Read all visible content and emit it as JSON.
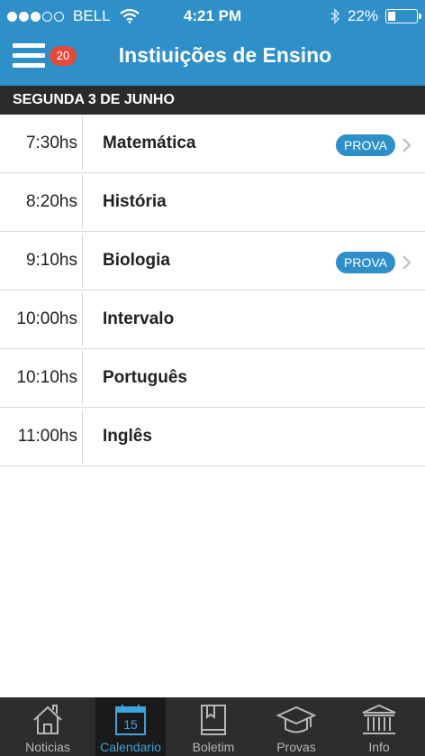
{
  "status_bar": {
    "carrier": "BELL",
    "time": "4:21 PM",
    "battery": "22%",
    "battery_level": 0.22
  },
  "header": {
    "title": "Instiuições de Ensino",
    "badge_count": "20"
  },
  "date_header": "SEGUNDA 3 DE JUNHO",
  "schedule": [
    {
      "time": "7:30hs",
      "subject": "Matemática",
      "tag": "PROVA"
    },
    {
      "time": "8:20hs",
      "subject": "História"
    },
    {
      "time": "9:10hs",
      "subject": "Biologia",
      "tag": "PROVA"
    },
    {
      "time": "10:00hs",
      "subject": "Intervalo"
    },
    {
      "time": "10:10hs",
      "subject": "Português"
    },
    {
      "time": "11:00hs",
      "subject": "Inglês"
    }
  ],
  "tabbar": {
    "items": [
      {
        "label": "Noticias",
        "icon": "house-icon"
      },
      {
        "label": "Calendario",
        "icon": "calendar-icon",
        "day": "15",
        "active": true
      },
      {
        "label": "Boletim",
        "icon": "book-icon"
      },
      {
        "label": "Provas",
        "icon": "graduation-cap-icon"
      },
      {
        "label": "Info",
        "icon": "building-icon"
      }
    ]
  },
  "colors": {
    "accent": "#2e8fc9",
    "badge": "#e34a3a",
    "date_bar": "#2a2a2a",
    "tabbar": "#2d2d2d",
    "tab_active_text": "#3ea4e0"
  }
}
